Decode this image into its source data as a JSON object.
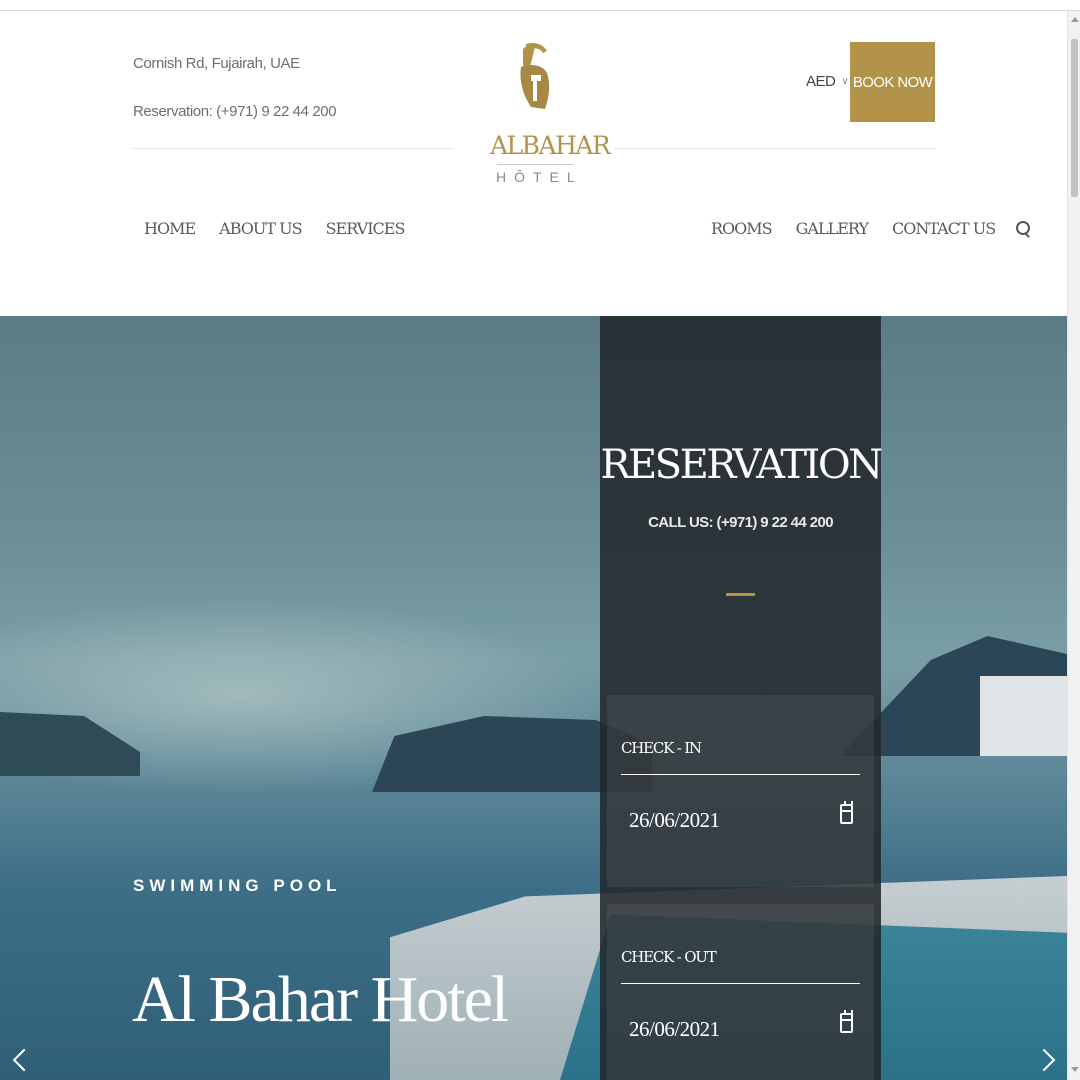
{
  "header": {
    "address": "Cornish Rd, Fujairah, UAE",
    "reservation": "Reservation: (+971) 9 22 44 200",
    "currency": "AED",
    "book_now": "BOOK NOW"
  },
  "logo": {
    "brand": "ALBAHAR",
    "sub": "HÔTEL"
  },
  "nav": {
    "left": [
      "HOME",
      "ABOUT US",
      "SERVICES"
    ],
    "right": [
      "ROOMS",
      "GALLERY",
      "CONTACT US"
    ]
  },
  "hero": {
    "label": "SWIMMING POOL",
    "title": "Al Bahar Hotel"
  },
  "reservation_panel": {
    "title": "RESERVATION",
    "call": "CALL US: (+971) 9 22 44 200",
    "check_in_label": "CHECK - IN",
    "check_in_value": "26/06/2021",
    "check_out_label": "CHECK - OUT",
    "check_out_value": "26/06/2021"
  },
  "colors": {
    "accent": "#b3924a",
    "panel": "#22282c"
  }
}
